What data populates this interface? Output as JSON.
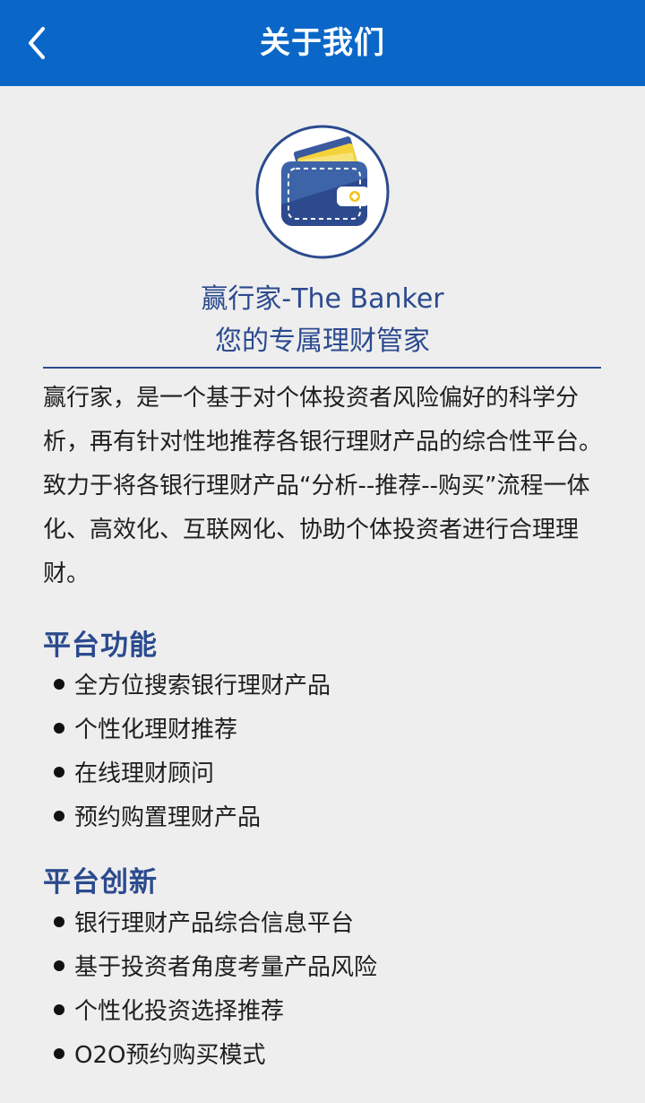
{
  "header": {
    "title": "关于我们",
    "back_icon": "chevron-left-icon"
  },
  "colors": {
    "header_bg": "#0a67c8",
    "accent": "#2b4a8e",
    "background": "#eeeeee"
  },
  "brand": {
    "logo_icon": "wallet-icon",
    "name": "赢行家-The Banker",
    "slogan": "您的专属理财管家"
  },
  "intro": {
    "lines": [
      "赢行家，是一个基于对个体投资者风险偏好的科学分",
      "析，再有针对性地推荐各银行理财产品的综合性平台。",
      "致力于将各银行理财产品“分析--推荐--购买”流程一体",
      "化、高效化、互联网化、协助个体投资者进行合理理",
      "财。"
    ]
  },
  "features": {
    "title": "平台功能",
    "items": [
      "全方位搜索银行理财产品",
      "个性化理财推荐",
      "在线理财顾问",
      "预约购置理财产品"
    ]
  },
  "innovation": {
    "title": "平台创新",
    "items": [
      "银行理财产品综合信息平台",
      "基于投资者角度考量产品风险",
      "个性化投资选择推荐",
      "O2O预约购买模式"
    ]
  }
}
